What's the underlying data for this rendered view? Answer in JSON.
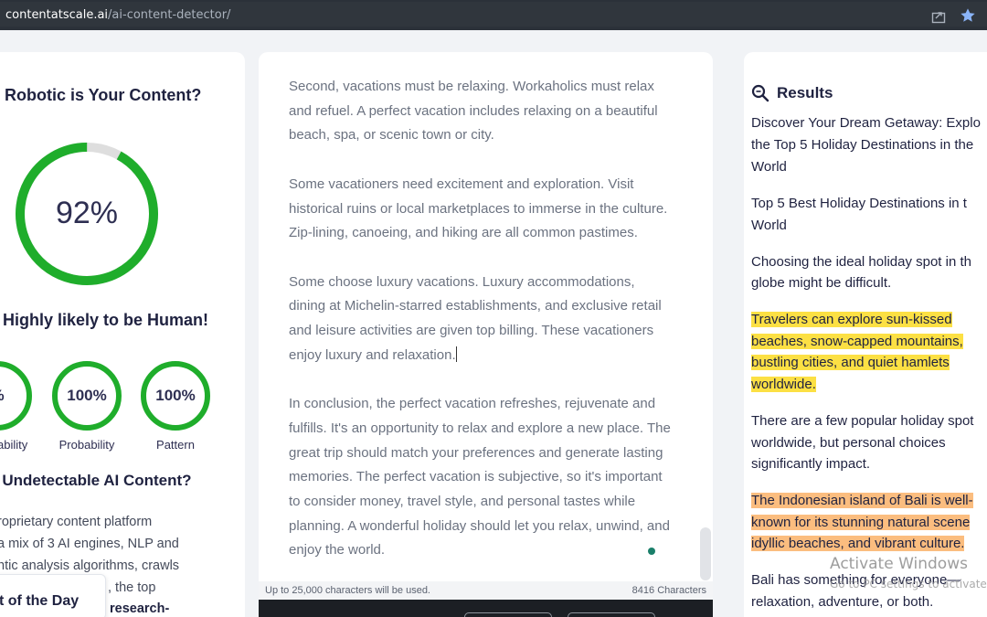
{
  "browser": {
    "url_host": "contentatscale.ai",
    "url_path": "/ai-content-detector/"
  },
  "left": {
    "title": "w Robotic is Your Content?",
    "score": "92%",
    "score_fraction": 0.92,
    "verdict": "Highly likely to be Human!",
    "rings": [
      {
        "value": "%",
        "label": "ability"
      },
      {
        "value": "100%",
        "label": "Probability"
      },
      {
        "value": "100%",
        "label": "Pattern"
      }
    ],
    "subtitle": "t Undetectable AI Content?",
    "para_lines": [
      "roprietary content platform",
      "a mix of 3 AI engines, NLP and",
      "ntic analysis algorithms, crawls",
      ", the top",
      "research-"
    ],
    "promo_label": "t of the Day"
  },
  "middle": {
    "paragraphs": [
      "Second, vacations must be relaxing. Workaholics must relax and refuel. A perfect vacation includes relaxing on a beautiful beach, spa, or scenic town or city.",
      "Some vacationers need excitement and exploration. Visit historical ruins or local marketplaces to immerse in the culture. Zip-lining, canoeing, and hiking are all common pastimes.",
      "Some choose luxury vacations. Luxury accommodations, dining at Michelin-starred establishments, and exclusive retail and leisure activities are given top billing. These vacationers enjoy luxury and relaxation.",
      "In conclusion, the perfect vacation refreshes, rejuvenate and fulfills. It's an opportunity to relax and explore a new place. The great trip should match your preferences and generate lasting memories. The perfect vacation is subjective, so it's important to consider money, travel style, and personal tastes while planning. A wonderful holiday should let you relax, unwind, and enjoy the world."
    ],
    "limit_note": "Up to 25,000 characters will be used.",
    "char_count": "8416 Characters"
  },
  "results": {
    "heading": "Results",
    "lines": [
      {
        "text": "Discover Your Dream Getaway: Explo",
        "hl": ""
      },
      {
        "text": "the Top 5 Holiday Destinations in the",
        "hl": ""
      },
      {
        "text": "World",
        "hl": ""
      },
      {
        "text": "Top 5 Best Holiday Destinations in t",
        "hl": ""
      },
      {
        "text": "World",
        "hl": ""
      },
      {
        "text": "Choosing the ideal holiday spot in th",
        "hl": ""
      },
      {
        "text": "globe might be difficult.",
        "hl": ""
      },
      {
        "text": "Travelers can explore sun-kissed",
        "hl": "y"
      },
      {
        "text": "beaches, snow-capped mountains,",
        "hl": "y"
      },
      {
        "text": "bustling cities, and quiet hamlets",
        "hl": "y"
      },
      {
        "text": "worldwide.",
        "hl": "y"
      },
      {
        "text": "There are a few popular holiday spot",
        "hl": ""
      },
      {
        "text": "worldwide, but personal choices",
        "hl": ""
      },
      {
        "text": "significantly impact.",
        "hl": ""
      },
      {
        "text": "The Indonesian island of Bali is well-",
        "hl": "o"
      },
      {
        "text": "known for its stunning natural scene",
        "hl": "o"
      },
      {
        "text": "idyllic beaches, and vibrant culture.",
        "hl": "o"
      },
      {
        "text": "Bali has something for everyone—",
        "hl": ""
      },
      {
        "text": "relaxation, adventure, or both.",
        "hl": ""
      }
    ]
  },
  "watermark": {
    "title": "Activate Windows",
    "subtitle": "Go to PC settings to activate"
  },
  "colors": {
    "accent_green": "#1fad2b",
    "ring_track": "#dedede",
    "highlight_yellow": "#fce044",
    "highlight_orange": "#fbbd7f"
  }
}
